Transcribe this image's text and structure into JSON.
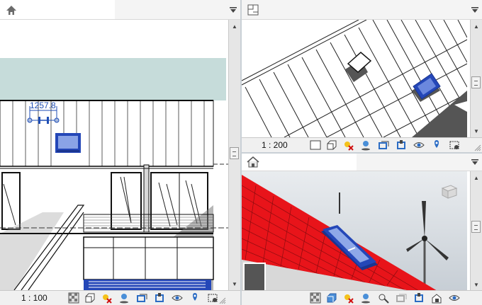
{
  "views": {
    "elevation": {
      "dimension_label": "1257.8",
      "scale": "1 : 100"
    },
    "plan": {
      "scale": "1 : 200"
    },
    "three_d": {}
  },
  "colors": {
    "roof_red": "#e8141a",
    "skylight_blue": "#2447b8",
    "sky_teal": "#c6dcda",
    "dimension_blue": "#1f4eb5"
  },
  "icons": {
    "elevation_view": "elevation-view-icon",
    "plan_view": "plan-view-icon",
    "three_d_view": "3d-house-icon",
    "dropdown": "triangle-down-icon"
  }
}
